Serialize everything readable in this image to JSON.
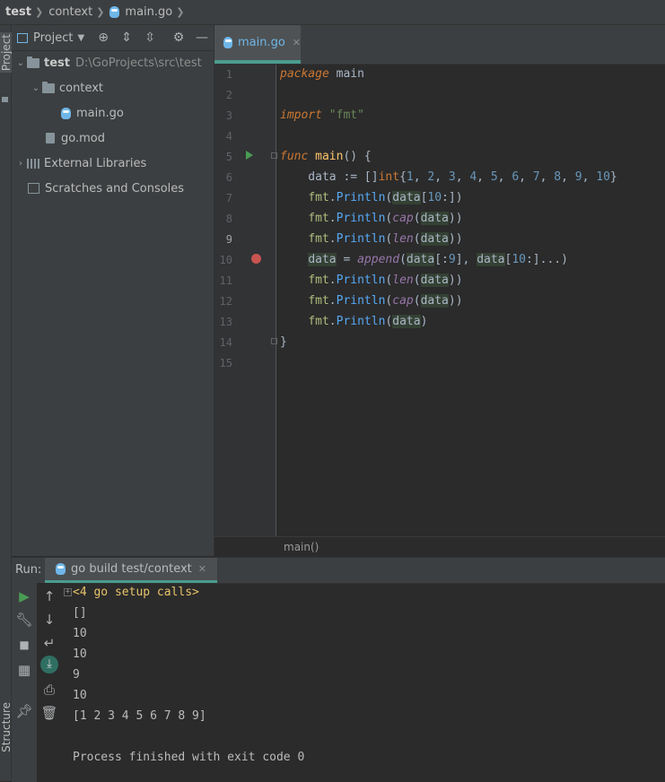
{
  "breadcrumb": [
    "test",
    "context",
    "main.go"
  ],
  "left_strip": {
    "project": "Project",
    "structure": "Structure"
  },
  "project_panel": {
    "title": "Project",
    "tree": [
      {
        "name": "test",
        "detail": "D:\\GoProjects\\src\\test"
      },
      {
        "name": "context"
      },
      {
        "name": "main.go"
      },
      {
        "name": "go.mod"
      },
      {
        "name": "External Libraries"
      },
      {
        "name": "Scratches and Consoles"
      }
    ]
  },
  "editor": {
    "tab": "main.go",
    "line_numbers": [
      "1",
      "2",
      "3",
      "4",
      "5",
      "6",
      "7",
      "8",
      "9",
      "10",
      "11",
      "12",
      "13",
      "14",
      "15"
    ],
    "status": "main()"
  },
  "run": {
    "label": "Run:",
    "tab": "go build test/context",
    "output": [
      "<4 go setup calls>",
      "[]",
      "10",
      "10",
      "9",
      "10",
      "[1 2 3 4 5 6 7 8 9]",
      "",
      "Process finished with exit code 0"
    ]
  },
  "colors": {
    "accent": "#4a9c8e",
    "breakpoint": "#c75450",
    "run": "#499c54"
  }
}
